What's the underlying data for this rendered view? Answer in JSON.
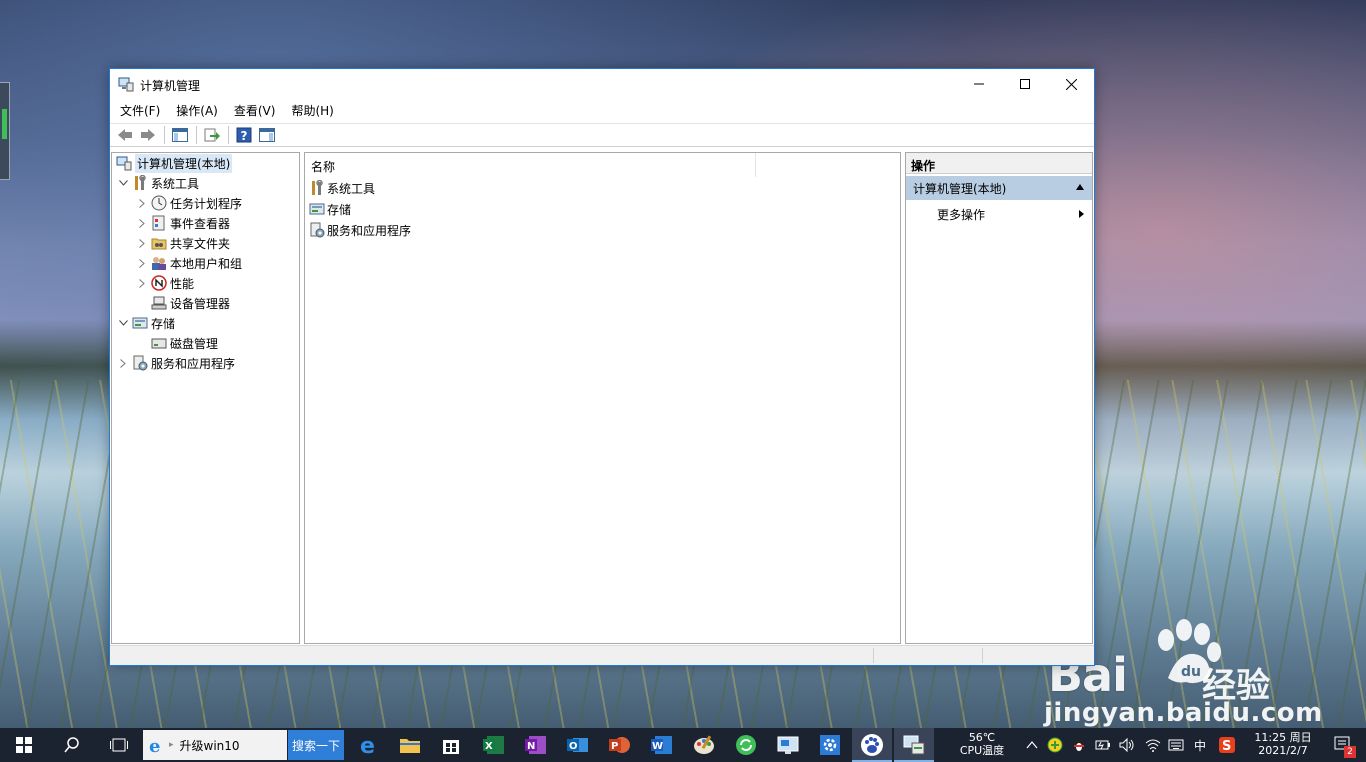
{
  "window": {
    "title": "计算机管理",
    "menu": [
      "文件(F)",
      "操作(A)",
      "查看(V)",
      "帮助(H)"
    ]
  },
  "tree": {
    "root": "计算机管理(本地)",
    "items": [
      {
        "label": "系统工具",
        "icon": "tools-icon"
      },
      {
        "label": "任务计划程序",
        "icon": "clock-icon"
      },
      {
        "label": "事件查看器",
        "icon": "event-viewer-icon"
      },
      {
        "label": "共享文件夹",
        "icon": "shared-folder-icon"
      },
      {
        "label": "本地用户和组",
        "icon": "users-icon"
      },
      {
        "label": "性能",
        "icon": "performance-icon"
      },
      {
        "label": "设备管理器",
        "icon": "device-manager-icon"
      },
      {
        "label": "存储",
        "icon": "storage-icon"
      },
      {
        "label": "磁盘管理",
        "icon": "disk-icon"
      },
      {
        "label": "服务和应用程序",
        "icon": "services-icon"
      }
    ]
  },
  "list": {
    "column_name": "名称",
    "items": [
      "系统工具",
      "存储",
      "服务和应用程序"
    ]
  },
  "actions": {
    "header": "操作",
    "section": "计算机管理(本地)",
    "more": "更多操作"
  },
  "taskbar": {
    "search_text": "升级win10",
    "search_button": "搜索一下",
    "temp": "56℃",
    "temp_label": "CPU温度",
    "ime": "中",
    "time": "11:25 周日",
    "date": "2021/2/7",
    "notification_count": "2"
  },
  "watermark": {
    "brand": "Bai",
    "site": "经验",
    "url": "jingyan.baidu.com"
  }
}
